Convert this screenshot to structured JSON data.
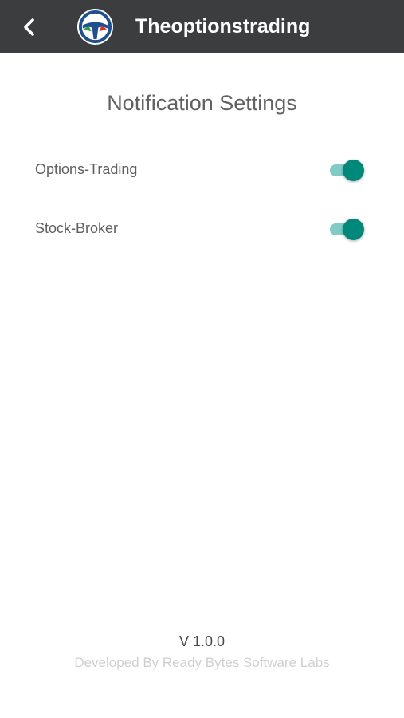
{
  "app_bar": {
    "title": "Theoptionstrading",
    "back_icon": "chevron-left-icon",
    "logo_icon": "steering-wheel-logo",
    "background_color": "#3b3d3e"
  },
  "page": {
    "title": "Notification Settings"
  },
  "settings": [
    {
      "label": "Options-Trading",
      "enabled": true
    },
    {
      "label": "Stock-Broker",
      "enabled": true
    }
  ],
  "toggle_colors": {
    "track_on": "#80cbc4",
    "knob_on": "#00897b"
  },
  "footer": {
    "version": "V 1.0.0",
    "developer": "Developed By Ready Bytes Software Labs"
  }
}
